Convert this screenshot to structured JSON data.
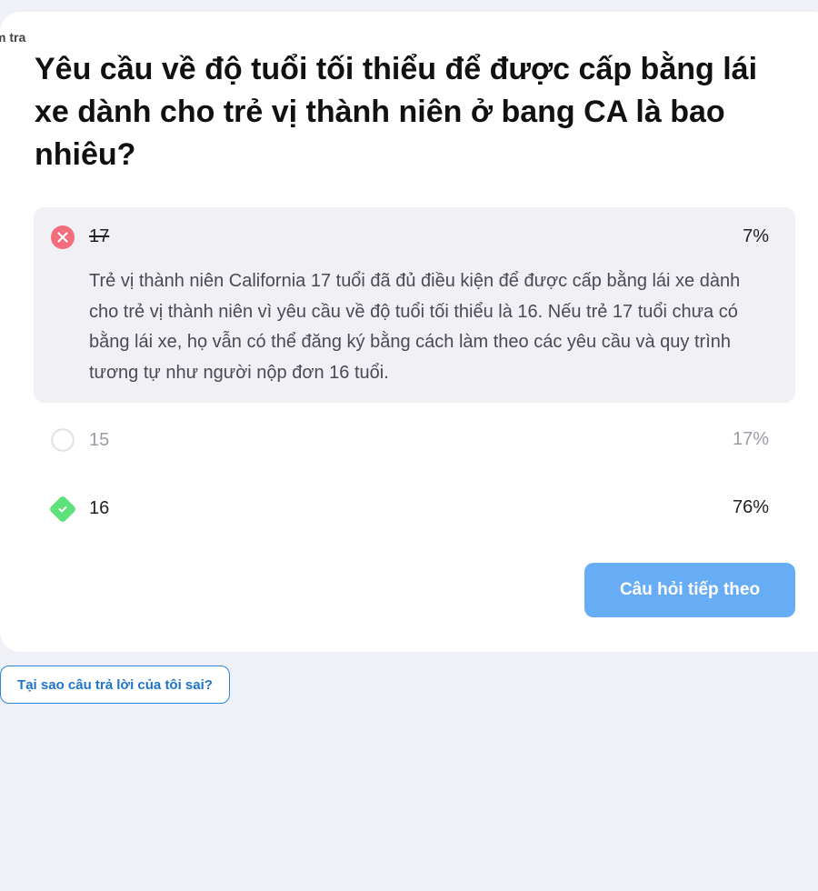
{
  "breadcrumb": "m tra",
  "question": "Yêu cầu về độ tuổi tối thiểu để được cấp bằng lái xe dành cho trẻ vị thành niên ở bang CA là bao nhiêu?",
  "options": [
    {
      "label": "17",
      "percent": "7%",
      "state": "wrong-selected",
      "explanation": "Trẻ vị thành niên California 17 tuổi đã đủ điều kiện để được cấp bằng lái xe dành cho trẻ vị thành niên vì yêu cầu về độ tuổi tối thiểu là 16. Nếu trẻ 17 tuổi chưa có bằng lái xe, họ vẫn có thể đăng ký bằng cách làm theo các yêu cầu và quy trình tương tự như người nộp đơn 16 tuổi."
    },
    {
      "label": "15",
      "percent": "17%",
      "state": "unselected"
    },
    {
      "label": "16",
      "percent": "76%",
      "state": "correct"
    }
  ],
  "buttons": {
    "next": "Câu hỏi tiếp theo",
    "why_wrong": "Tại sao câu trả lời của tôi sai?"
  },
  "colors": {
    "wrong": "#f26e7d",
    "correct": "#5ee07a",
    "primary_button": "#66adf6",
    "link": "#1f74c9",
    "selected_bg": "#f0f0f5"
  },
  "icons": {
    "wrong": "x-circle-icon",
    "unselected": "empty-circle-icon",
    "correct": "check-diamond-icon"
  }
}
